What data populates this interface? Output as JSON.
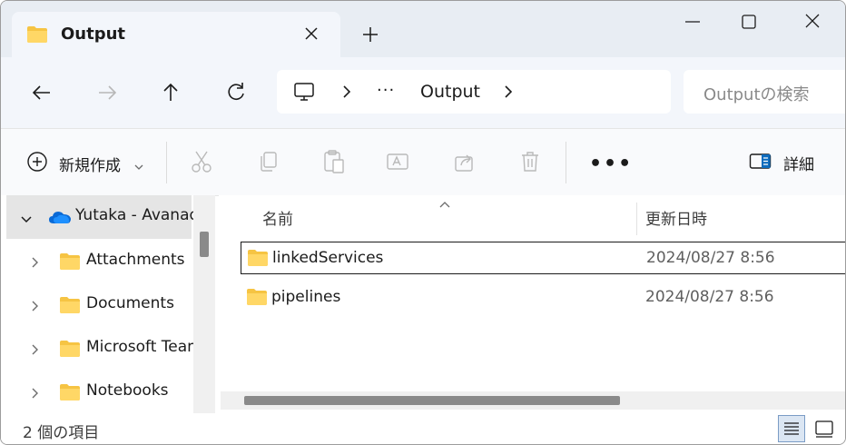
{
  "tab": {
    "title": "Output",
    "icon": "folder-icon"
  },
  "address": {
    "more": "···",
    "crumb": "Output"
  },
  "search": {
    "placeholder": "Outputの検索"
  },
  "toolbar": {
    "new_label": "新規作成",
    "more": "•••",
    "details_label": "詳細"
  },
  "sidebar": {
    "root": {
      "label": "Yutaka - Avanad",
      "icon": "onedrive-cloud-icon"
    },
    "items": [
      {
        "label": "Attachments"
      },
      {
        "label": "Documents"
      },
      {
        "label": "Microsoft Team"
      },
      {
        "label": "Notebooks"
      }
    ]
  },
  "columns": {
    "name": "名前",
    "date": "更新日時"
  },
  "files": [
    {
      "name": "linkedServices",
      "date": "2024/08/27 8:56",
      "selected": true
    },
    {
      "name": "pipelines",
      "date": "2024/08/27 8:56",
      "selected": false
    }
  ],
  "status": {
    "count": "2 個の項目"
  },
  "colors": {
    "folder": "#f6c443",
    "accent": "#0f6cbd",
    "onedrive": "#0a6ad6"
  }
}
